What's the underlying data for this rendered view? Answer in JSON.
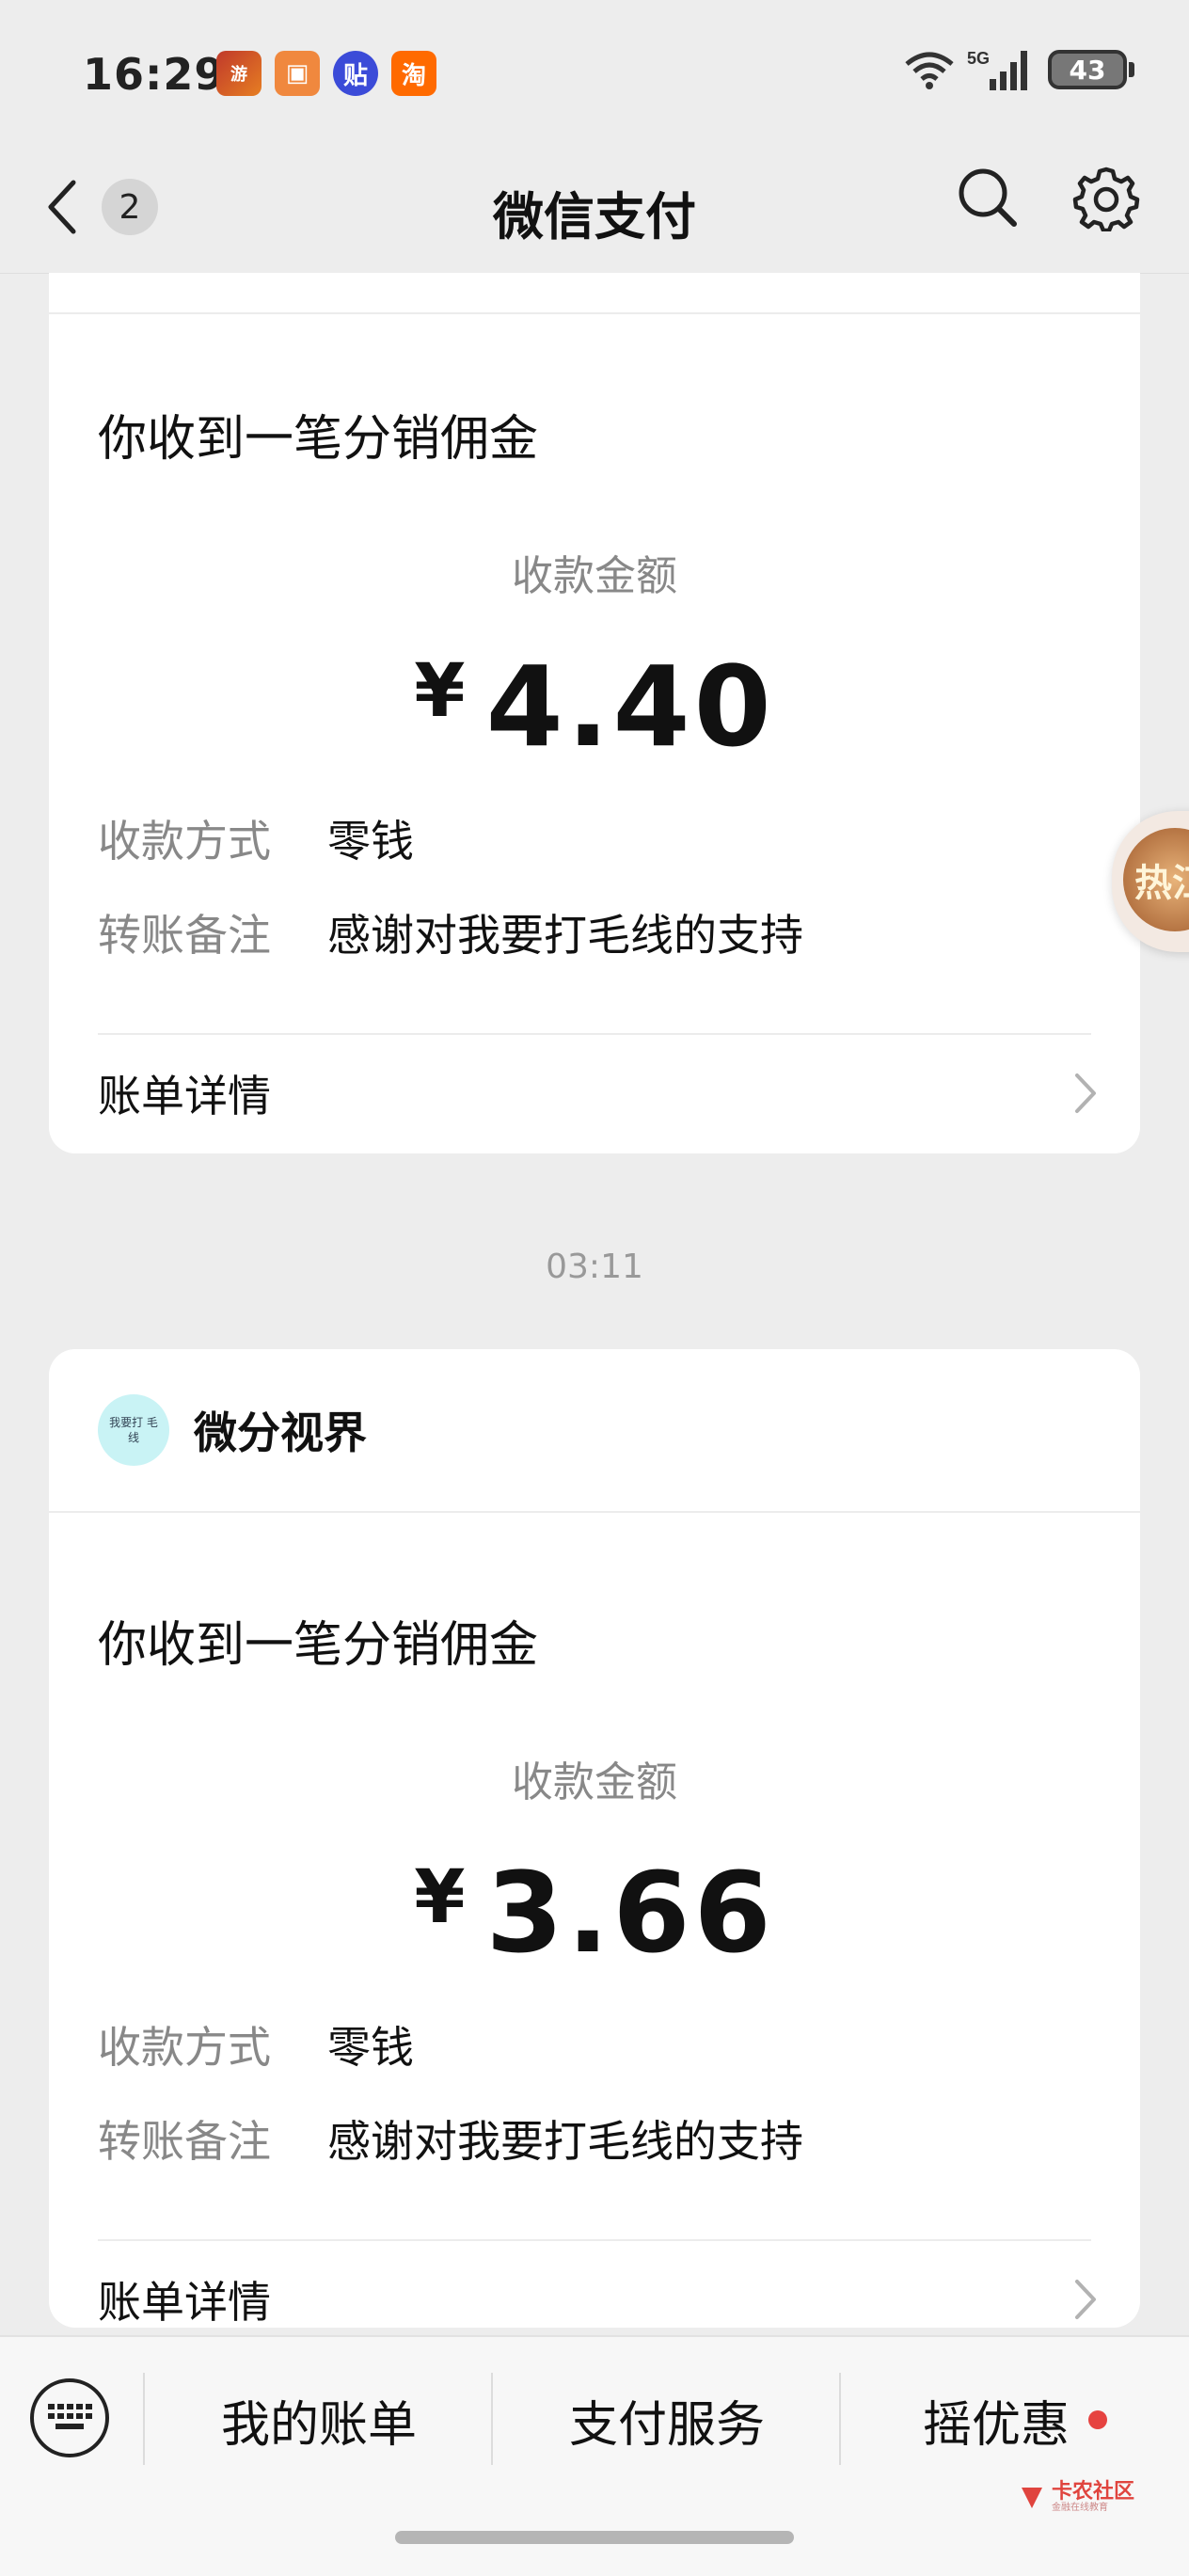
{
  "status_bar": {
    "time": "16:29",
    "battery": "43",
    "network": "5G"
  },
  "nav": {
    "back_badge": "2",
    "title": "微信支付"
  },
  "messages": [
    {
      "title": "你收到一笔分销佣金",
      "amount_label": "收款金额",
      "currency": "¥",
      "amount": "4.40",
      "method_key": "收款方式",
      "method_value": "零钱",
      "note_key": "转账备注",
      "note_value": "感谢对我要打毛线的支持",
      "detail_label": "账单详情"
    },
    {
      "merchant_name": "微分视界",
      "merchant_avatar_text": "我要打 毛线",
      "title": "你收到一笔分销佣金",
      "amount_label": "收款金额",
      "currency": "¥",
      "amount": "3.66",
      "method_key": "收款方式",
      "method_value": "零钱",
      "note_key": "转账备注",
      "note_value": "感谢对我要打毛线的支持",
      "detail_label": "账单详情"
    }
  ],
  "timestamp": "03:11",
  "bottom_menu": {
    "item1": "我的账单",
    "item2": "支付服务",
    "item3": "摇优惠"
  },
  "watermark": {
    "title": "卡农社区",
    "subtitle": "金融在线教育"
  },
  "floating_ball": {
    "text": "热江"
  },
  "colors": {
    "background": "#ededed",
    "card": "#ffffff",
    "red_dot": "#e64340",
    "muted": "#888888"
  }
}
